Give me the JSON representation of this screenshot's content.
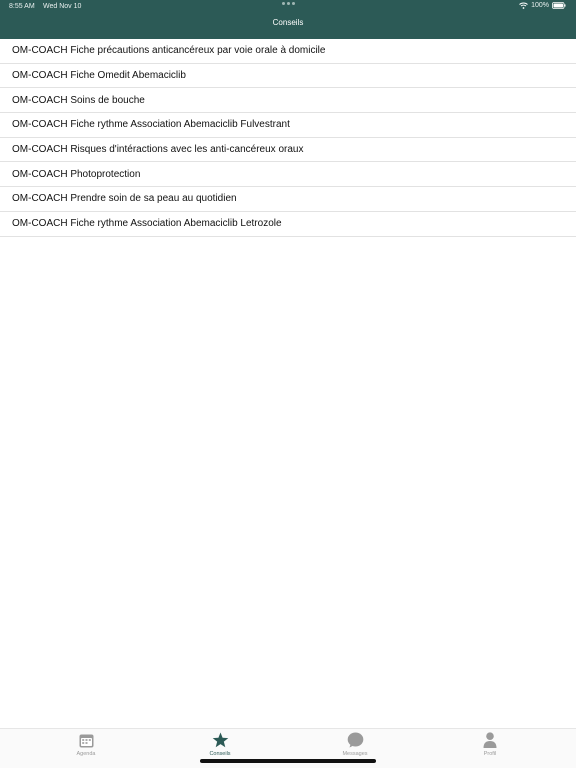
{
  "status_bar": {
    "time": "8:55 AM",
    "date": "Wed Nov 10",
    "battery": "100%"
  },
  "nav": {
    "title": "Conseils"
  },
  "list": {
    "items": [
      "OM-COACH Fiche précautions anticancéreux par voie orale à domicile",
      "OM-COACH Fiche Omedit Abemaciclib",
      "OM-COACH Soins de bouche",
      "OM-COACH Fiche rythme Association Abemaciclib Fulvestrant",
      "OM-COACH Risques d'intéractions avec les anti-cancéreux oraux",
      "OM-COACH Photoprotection",
      "OM-COACH Prendre soin de sa peau au quotidien",
      "OM-COACH Fiche rythme Association Abemaciclib Letrozole"
    ]
  },
  "tabbar": {
    "tabs": [
      {
        "label": "Agenda",
        "icon": "calendar-icon",
        "active": false
      },
      {
        "label": "Conseils",
        "icon": "star-icon",
        "active": true
      },
      {
        "label": "Messages",
        "icon": "chat-bubble-icon",
        "active": false
      },
      {
        "label": "Profil",
        "icon": "person-icon",
        "active": false
      }
    ]
  },
  "colors": {
    "header": "#2c5a56",
    "active_tab": "#2c5a56",
    "inactive_tab": "#9a9a9a"
  }
}
